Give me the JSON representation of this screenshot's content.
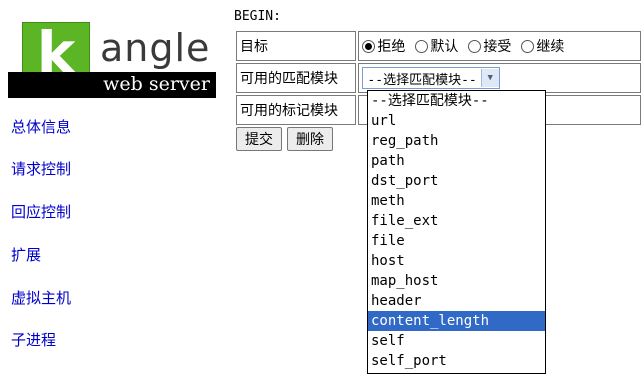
{
  "logo": {
    "k": "k",
    "name": "angle",
    "subtitle": "web server"
  },
  "nav": [
    "总体信息",
    "请求控制",
    "回应控制",
    "扩展",
    "虚拟主机",
    "子进程"
  ],
  "form": {
    "begin": "BEGIN:",
    "rows": [
      {
        "label": "目标"
      },
      {
        "label": "可用的匹配模块"
      },
      {
        "label": "可用的标记模块"
      }
    ],
    "radios": [
      {
        "label": "拒绝",
        "checked": true
      },
      {
        "label": "默认",
        "checked": false
      },
      {
        "label": "接受",
        "checked": false
      },
      {
        "label": "继续",
        "checked": false
      }
    ],
    "select_value": "--选择匹配模块--",
    "submit_label": "提交",
    "delete_label": "删除"
  },
  "dropdown": {
    "options": [
      "--选择匹配模块--",
      "url",
      "reg_path",
      "path",
      "dst_port",
      "meth",
      "file_ext",
      "file",
      "host",
      "map_host",
      "header",
      "content_length",
      "self",
      "self_port"
    ],
    "highlighted": 11
  },
  "colors": {
    "logo_green": "#5cb525",
    "link": "#0000cc",
    "highlight": "#3169c6"
  }
}
